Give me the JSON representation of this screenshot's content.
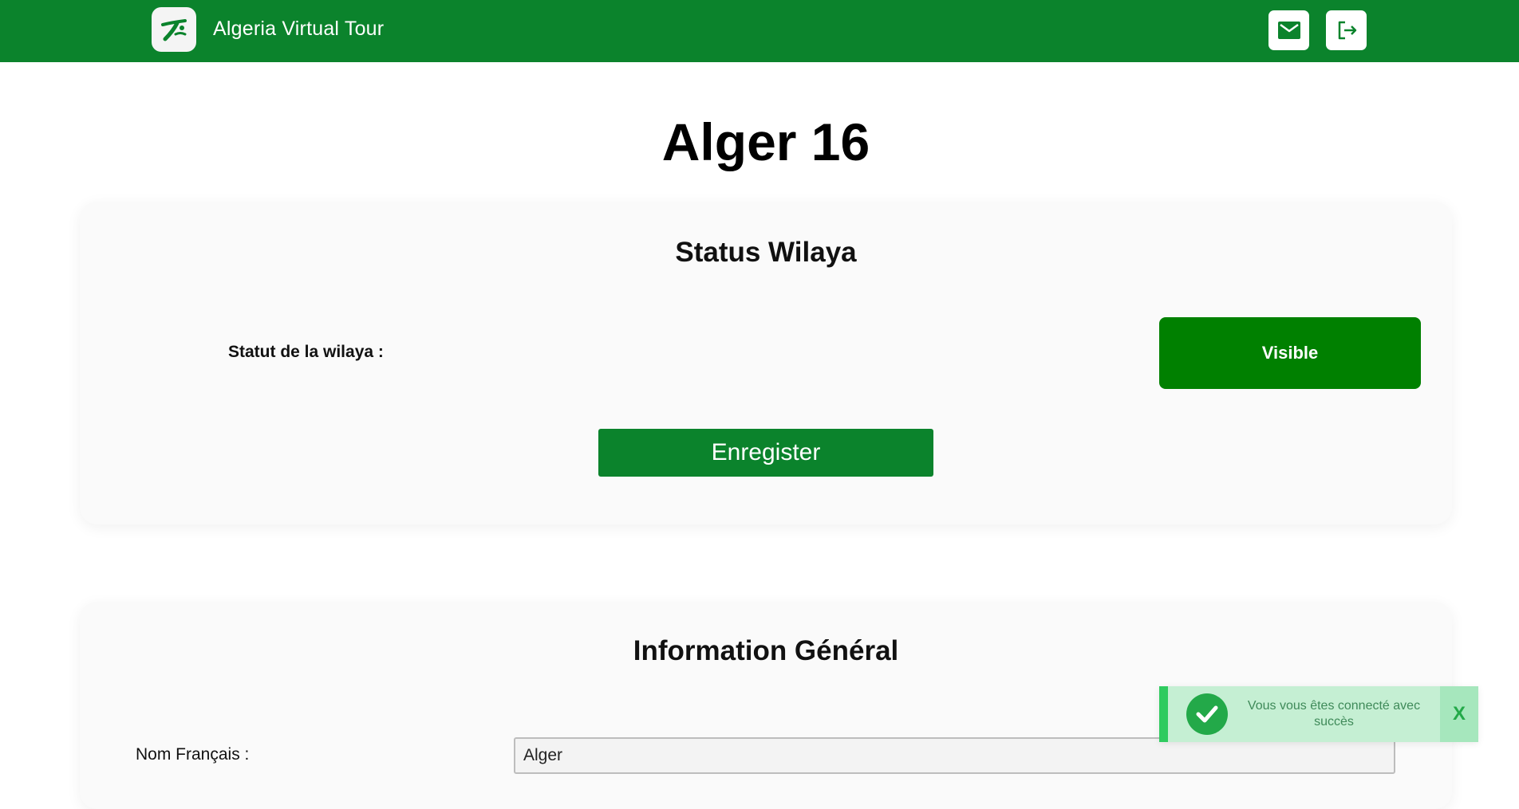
{
  "header": {
    "app_title": "Algeria Virtual Tour",
    "logo_icon": "algeria-virtual-tour-logo",
    "mail_icon": "mail-icon",
    "logout_icon": "logout-icon",
    "brand_color": "#0b832c"
  },
  "page": {
    "title": "Alger 16"
  },
  "status_card": {
    "title": "Status Wilaya",
    "status_label": "Statut de la wilaya :",
    "status_value": "Visible",
    "save_label": "Enregister"
  },
  "info_card": {
    "title": "Information Général",
    "nom_francais_label": "Nom Français :",
    "nom_francais_value": "Alger"
  },
  "toast": {
    "message": "Vous vous êtes connecté avec succès",
    "close_label": "X",
    "icon": "check-circle-icon",
    "color": "#2fcb5f"
  }
}
